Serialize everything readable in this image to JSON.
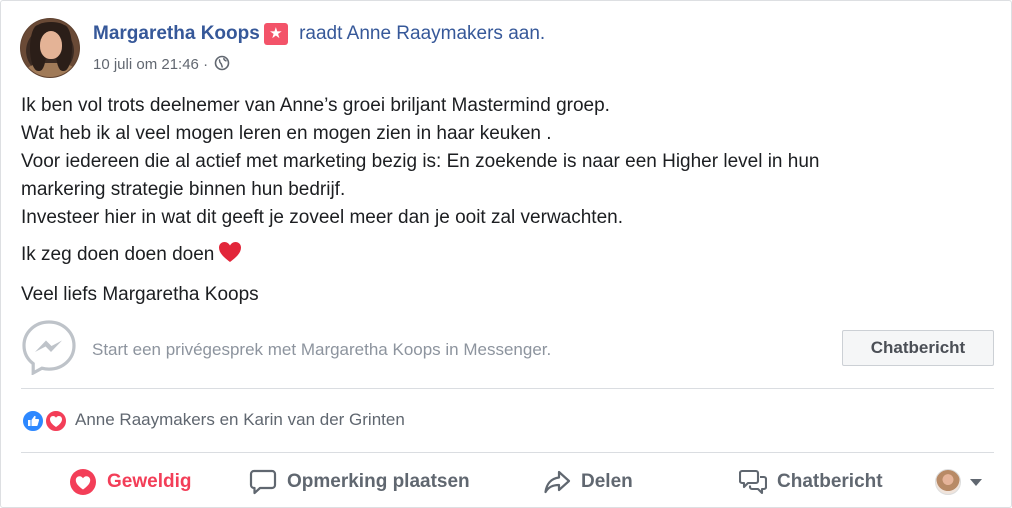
{
  "post": {
    "author": "Margaretha Koops",
    "recommend_verb": "raadt",
    "recommended_page": "Anne Raaymakers",
    "recommend_suffix": "aan.",
    "timestamp": "10 juli om 21:46",
    "separator": "·",
    "badge_icon": "star-icon",
    "paragraphs": [
      "Ik ben vol trots deelnemer van Anne’s groei briljant Mastermind groep.",
      "Wat heb ik al veel mogen leren en mogen zien in haar keuken .",
      "Voor iedereen die al actief met marketing bezig is: En zoekende is naar een Higher level in hun",
      "markering strategie binnen hun bedrijf.",
      "Investeer hier in wat dit geeft je zoveel meer dan je ooit zal verwachten."
    ],
    "line_2": "Ik zeg doen doen doen",
    "line_3": "Veel liefs Margaretha Koops"
  },
  "messenger": {
    "prompt": "Start een privégesprek met Margaretha Koops in Messenger.",
    "button_label": "Chatbericht"
  },
  "reactions": {
    "names": "Anne Raaymakers en Karin van der Grinten",
    "icons": [
      "like-icon",
      "love-icon"
    ]
  },
  "actions": {
    "love_label": "Geweldig",
    "comment_label": "Opmerking plaatsen",
    "share_label": "Delen",
    "chat_label": "Chatbericht"
  },
  "colors": {
    "link": "#365899",
    "love": "#f33e58",
    "like": "#2d88ff",
    "muted": "#606770",
    "badge": "#f35369"
  }
}
